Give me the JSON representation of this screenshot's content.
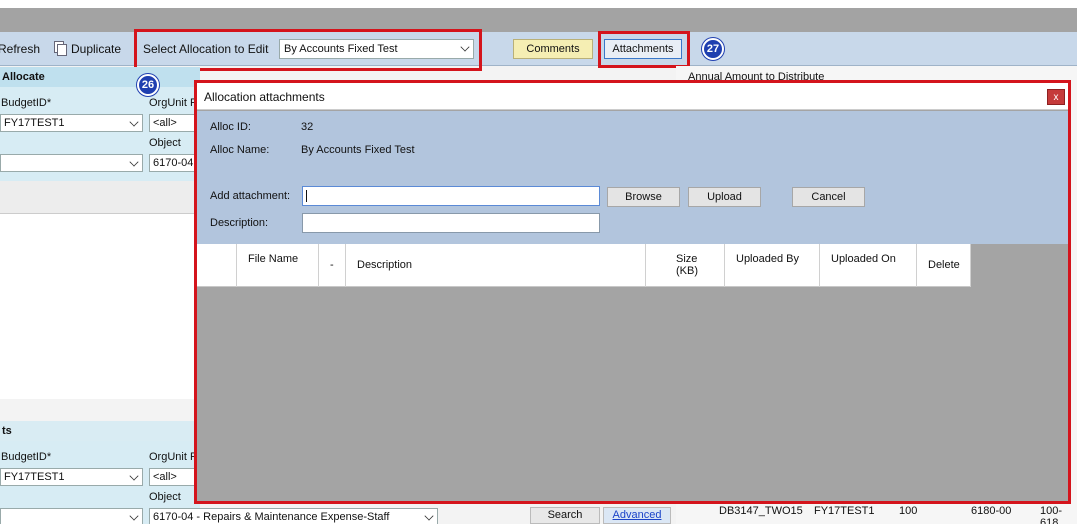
{
  "toolbar": {
    "refresh_label": "Refresh",
    "duplicate_label": "Duplicate",
    "select_label": "Select Allocation to Edit",
    "select_value": "By Accounts Fixed Test",
    "comments_label": "Comments",
    "attachments_label": "Attachments"
  },
  "badges": {
    "b26": "26",
    "b27": "27"
  },
  "allocate_section": {
    "title": "Allocate",
    "budget_label": "BudgetID*",
    "budget_value": "FY17TEST1",
    "orgunit_label": "OrgUnit R",
    "orgunit_value": "<all>",
    "object_label": "Object",
    "object_value": "6170-04"
  },
  "lower_section": {
    "title": "ts",
    "budget_label": "BudgetID*",
    "budget_value": "FY17TEST1",
    "orgunit_label": "OrgUnit R",
    "orgunit_value": "<all>",
    "object_label": "Object",
    "object_value": "6170-04 - Repairs & Maintenance Expense-Staff",
    "search_label": "Search",
    "advanced_label": "Advanced"
  },
  "right_panel": {
    "annual_label": "Annual Amount to Distribute",
    "bottom_row": [
      "DB3147_TWO15",
      "FY17TEST1",
      "100",
      "6180-00",
      "100-618"
    ]
  },
  "modal": {
    "title": "Allocation attachments",
    "close_label": "x",
    "alloc_id_label": "Alloc ID:",
    "alloc_id_value": "32",
    "alloc_name_label": "Alloc Name:",
    "alloc_name_value": "By Accounts Fixed Test",
    "add_attachment_label": "Add attachment:",
    "description_label": "Description:",
    "browse_label": "Browse",
    "upload_label": "Upload",
    "cancel_label": "Cancel",
    "columns": [
      "",
      "File Name",
      "-",
      "Description",
      "Size (KB)",
      "Uploaded By",
      "Uploaded On",
      "Delete"
    ]
  },
  "colors": {
    "highlight_frame": "#d4141c",
    "badge": "#1f3fb0",
    "toolbar_bg": "#c8d8ea",
    "modal_body_bg": "#b2c5dd"
  }
}
